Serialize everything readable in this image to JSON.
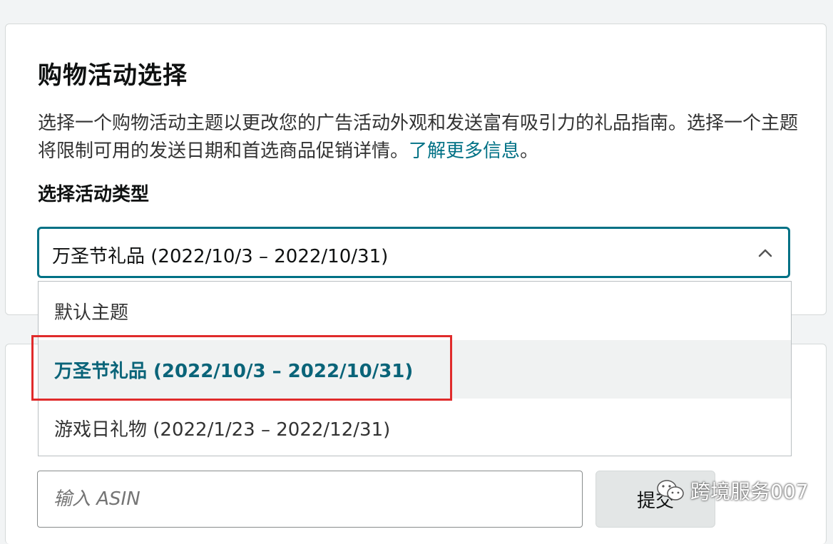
{
  "card": {
    "title": "购物活动选择",
    "description": "选择一个购物活动主题以更改您的广告活动外观和发送富有吸引力的礼品指南。选择一个主题将限制可用的发送日期和首选商品促销详情。",
    "learn_more": "了解更多信息",
    "description_end": "。"
  },
  "select": {
    "label": "选择活动类型",
    "value": "万圣节礼品 (2022/10/3 – 2022/10/31)",
    "options": [
      "默认主题",
      "万圣节礼品 (2022/10/3 – 2022/10/31)",
      "游戏日礼物 (2022/1/23 – 2022/12/31)"
    ],
    "selected_index": 1
  },
  "asin": {
    "placeholder": "输入 ASIN",
    "submit_label": "提交"
  },
  "watermark": {
    "text": "跨境服务007"
  },
  "colors": {
    "accent": "#007185",
    "highlight": "#e02b2b"
  }
}
